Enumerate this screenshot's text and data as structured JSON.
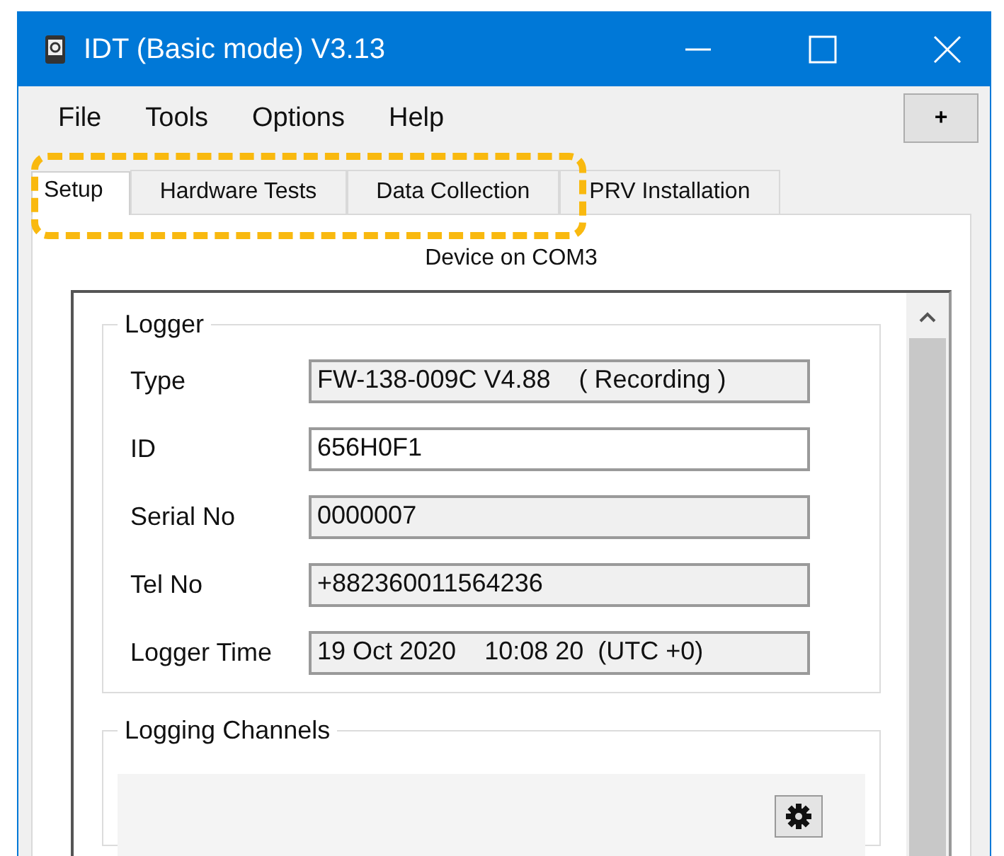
{
  "window": {
    "title": "IDT (Basic mode) V3.13"
  },
  "menu": [
    {
      "label": "File"
    },
    {
      "label": "Tools"
    },
    {
      "label": "Options"
    },
    {
      "label": "Help"
    }
  ],
  "menu_button": {
    "label": "+"
  },
  "tabs": [
    {
      "label": "Setup",
      "selected": true
    },
    {
      "label": "Hardware Tests",
      "selected": false
    },
    {
      "label": "Data Collection",
      "selected": false
    },
    {
      "label": "PRV Installation",
      "selected": false
    }
  ],
  "device_status": "Device on COM3",
  "logger": {
    "title": "Logger",
    "fields": [
      {
        "label": "Type",
        "value": "FW-138-009C V4.88    ( Recording )",
        "disabled": true
      },
      {
        "label": "ID",
        "value": "656H0F1",
        "disabled": false
      },
      {
        "label": "Serial No",
        "value": "0000007",
        "disabled": true
      },
      {
        "label": "Tel No",
        "value": "+882360011564236",
        "disabled": true
      },
      {
        "label": "Logger Time",
        "value": "19 Oct 2020    10:08 20  (UTC +0)",
        "disabled": true
      }
    ]
  },
  "logging_channels": {
    "title": "Logging Channels"
  }
}
